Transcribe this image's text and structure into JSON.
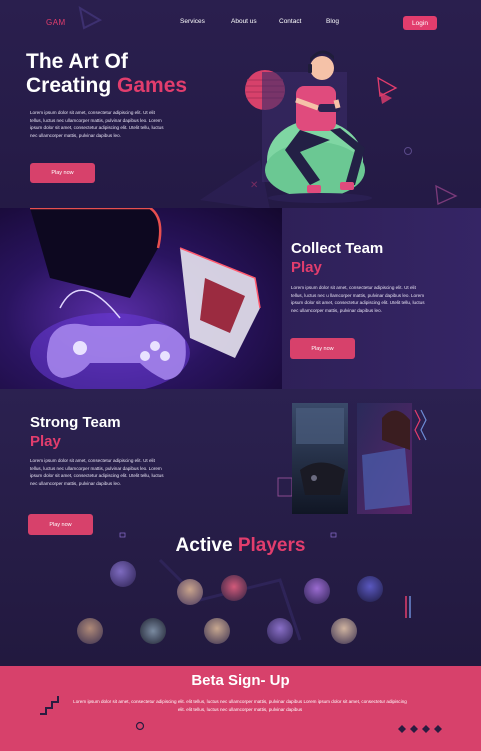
{
  "nav": {
    "logo": "GAM",
    "items": [
      "Services",
      "About us",
      "Contact",
      "Blog"
    ],
    "login": "Login"
  },
  "hero": {
    "title_line1": "The Art Of",
    "title_line2_a": "Creating ",
    "title_line2_b": "Games",
    "text": "Lorem ipsum dolor sit amet, consectetur adipiscing elit. Ut elit tellus, luctus nec ullamcorper mattis, pulvinar dapibus leo. Lorem ipsum dolor sit amet, consectetur adipiscing elit. Utelit tellu, luctus nec ullamcorper mattis, pulvinar dapibus leo.",
    "button": "Play now"
  },
  "collect": {
    "title_a": "Collect Team",
    "title_b": "Play",
    "text": "Lorem ipsum dolor sit amet, consectetur adipiscing elit. Ut elit tellus, luctus nec u llamcorper mattis, pulvinar dapibus leo. Lorem ipsum dolor sit amet, consectetur adipiscing elit. Utelit tellu, luctus nec ullamcorper mattis, pulvinar dapibus leo.",
    "button": "Play now"
  },
  "strong": {
    "title_a": "Strong Team",
    "title_b": "Play",
    "text": "Lorem ipsum dolor sit amet, consectetur adipiscing elit. Ut elit tellus, luctus nec ullamcorper mattis, pulvinar dapibus leo. Lorem ipsum dolor sit amet, consectetur adipiscing elit. Utelit tellu, luctus nec ullamcorper mattis, pulvinar dapibus leo.",
    "button": "Play now"
  },
  "players": {
    "title_a": "Active ",
    "title_b": "Players"
  },
  "beta": {
    "title": "Beta Sign- Up",
    "text": "Lorem ipsum dolor sit amet, consectetur adipiscing elit. elit tellus, luctus nec ullamcorper mattis, pulvinar dapibus Lorem ipsum dolor sit amet, consectetur adipiscing elit. elit tellus, luctus nec ullamcorper mattis, pulvinar dapibus"
  },
  "colors": {
    "accent": "#e23d6d",
    "background": "#251c45",
    "beta_band": "#d7416b"
  }
}
